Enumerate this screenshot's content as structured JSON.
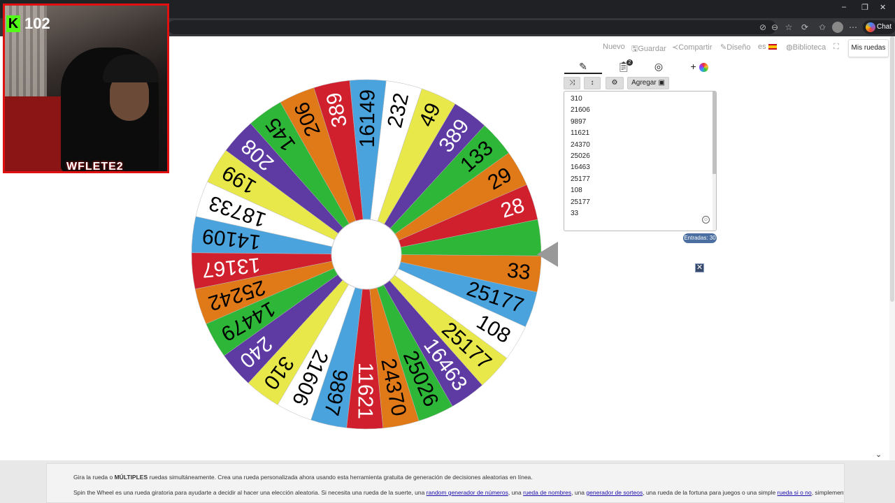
{
  "browser": {
    "window_controls": [
      "–",
      "❐",
      "✕"
    ],
    "chat_label": "Chat"
  },
  "stream_overlay": {
    "viewer_count": "102",
    "platform_icon": "K",
    "brand_logo": "WFLETE2"
  },
  "topnav": {
    "nuevo": "Nuevo",
    "guardar": "Guardar",
    "compartir": "Compartir",
    "diseno": "Diseño",
    "lang": "es",
    "biblioteca": "Biblioteca",
    "mis_ruedas": "Mis ruedas"
  },
  "wheel": {
    "segments": [
      {
        "label": "28",
        "color": "#d0202e"
      },
      {
        "label": "29",
        "color": "#e07a18"
      },
      {
        "label": "133",
        "color": "#2db637"
      },
      {
        "label": "389",
        "color": "#5e3ba3"
      },
      {
        "label": "49",
        "color": "#e8e84a"
      },
      {
        "label": "232",
        "color": "#ffffff"
      },
      {
        "label": "16149",
        "color": "#4aa3dd"
      },
      {
        "label": "389",
        "color": "#d0202e"
      },
      {
        "label": "206",
        "color": "#e07a18"
      },
      {
        "label": "145",
        "color": "#2db637"
      },
      {
        "label": "208",
        "color": "#5e3ba3"
      },
      {
        "label": "199",
        "color": "#e8e84a"
      },
      {
        "label": "18733",
        "color": "#ffffff"
      },
      {
        "label": "14109",
        "color": "#4aa3dd"
      },
      {
        "label": "13167",
        "color": "#d0202e"
      },
      {
        "label": "25242",
        "color": "#e07a18"
      },
      {
        "label": "14479",
        "color": "#2db637"
      },
      {
        "label": "240",
        "color": "#5e3ba3"
      },
      {
        "label": "310",
        "color": "#e8e84a"
      },
      {
        "label": "21606",
        "color": "#ffffff"
      },
      {
        "label": "9897",
        "color": "#4aa3dd"
      },
      {
        "label": "11621",
        "color": "#d0202e"
      },
      {
        "label": "24370",
        "color": "#e07a18"
      },
      {
        "label": "25026",
        "color": "#2db637"
      },
      {
        "label": "16463",
        "color": "#5e3ba3"
      },
      {
        "label": "25177",
        "color": "#e8e84a"
      },
      {
        "label": "108",
        "color": "#ffffff"
      },
      {
        "label": "25177",
        "color": "#4aa3dd"
      },
      {
        "label": "33",
        "color": "#e07a18"
      },
      {
        "label": "",
        "color": "#2db637"
      }
    ]
  },
  "panel": {
    "tab_icons": [
      "pencil-icon",
      "clipboard-icon",
      "eye-off-icon",
      "plus-palette-icon"
    ],
    "notif_count": "2",
    "shuffle_icon": "⤨",
    "sort_icon": "↕",
    "settings_icon": "⚙",
    "agregar_label": "Agregar",
    "entries": [
      "310",
      "21606",
      "9897",
      "11621",
      "24370",
      "25026",
      "16463",
      "25177",
      "108",
      "25177",
      "33"
    ],
    "entries_count": "Entradas: 30",
    "close_label": "✕"
  },
  "footer": {
    "line1_a": "Gira la rueda o ",
    "line1_b": "MÚLTIPLES",
    "line1_c": " ruedas simultáneamente. Crea una rueda personalizada ahora usando esta herramienta gratuita de generación de decisiones aleatorias en línea.",
    "line2_a": "Spin the Wheel es una rueda giratoria para ayudarte a decidir al hacer una elección aleatoria. Si necesita una rueda de la suerte, una ",
    "link1": "random generador de números",
    "line2_b": ", una ",
    "link2": "rueda de nombres",
    "line2_c": ", una ",
    "link3": "generador de sorteos",
    "line2_d": ", una rueda de la fortuna para juegos o una simple ",
    "link4": "rueda si o no",
    "line2_e": ", simplemente gira la rueda para obtener lo que necesitas."
  }
}
